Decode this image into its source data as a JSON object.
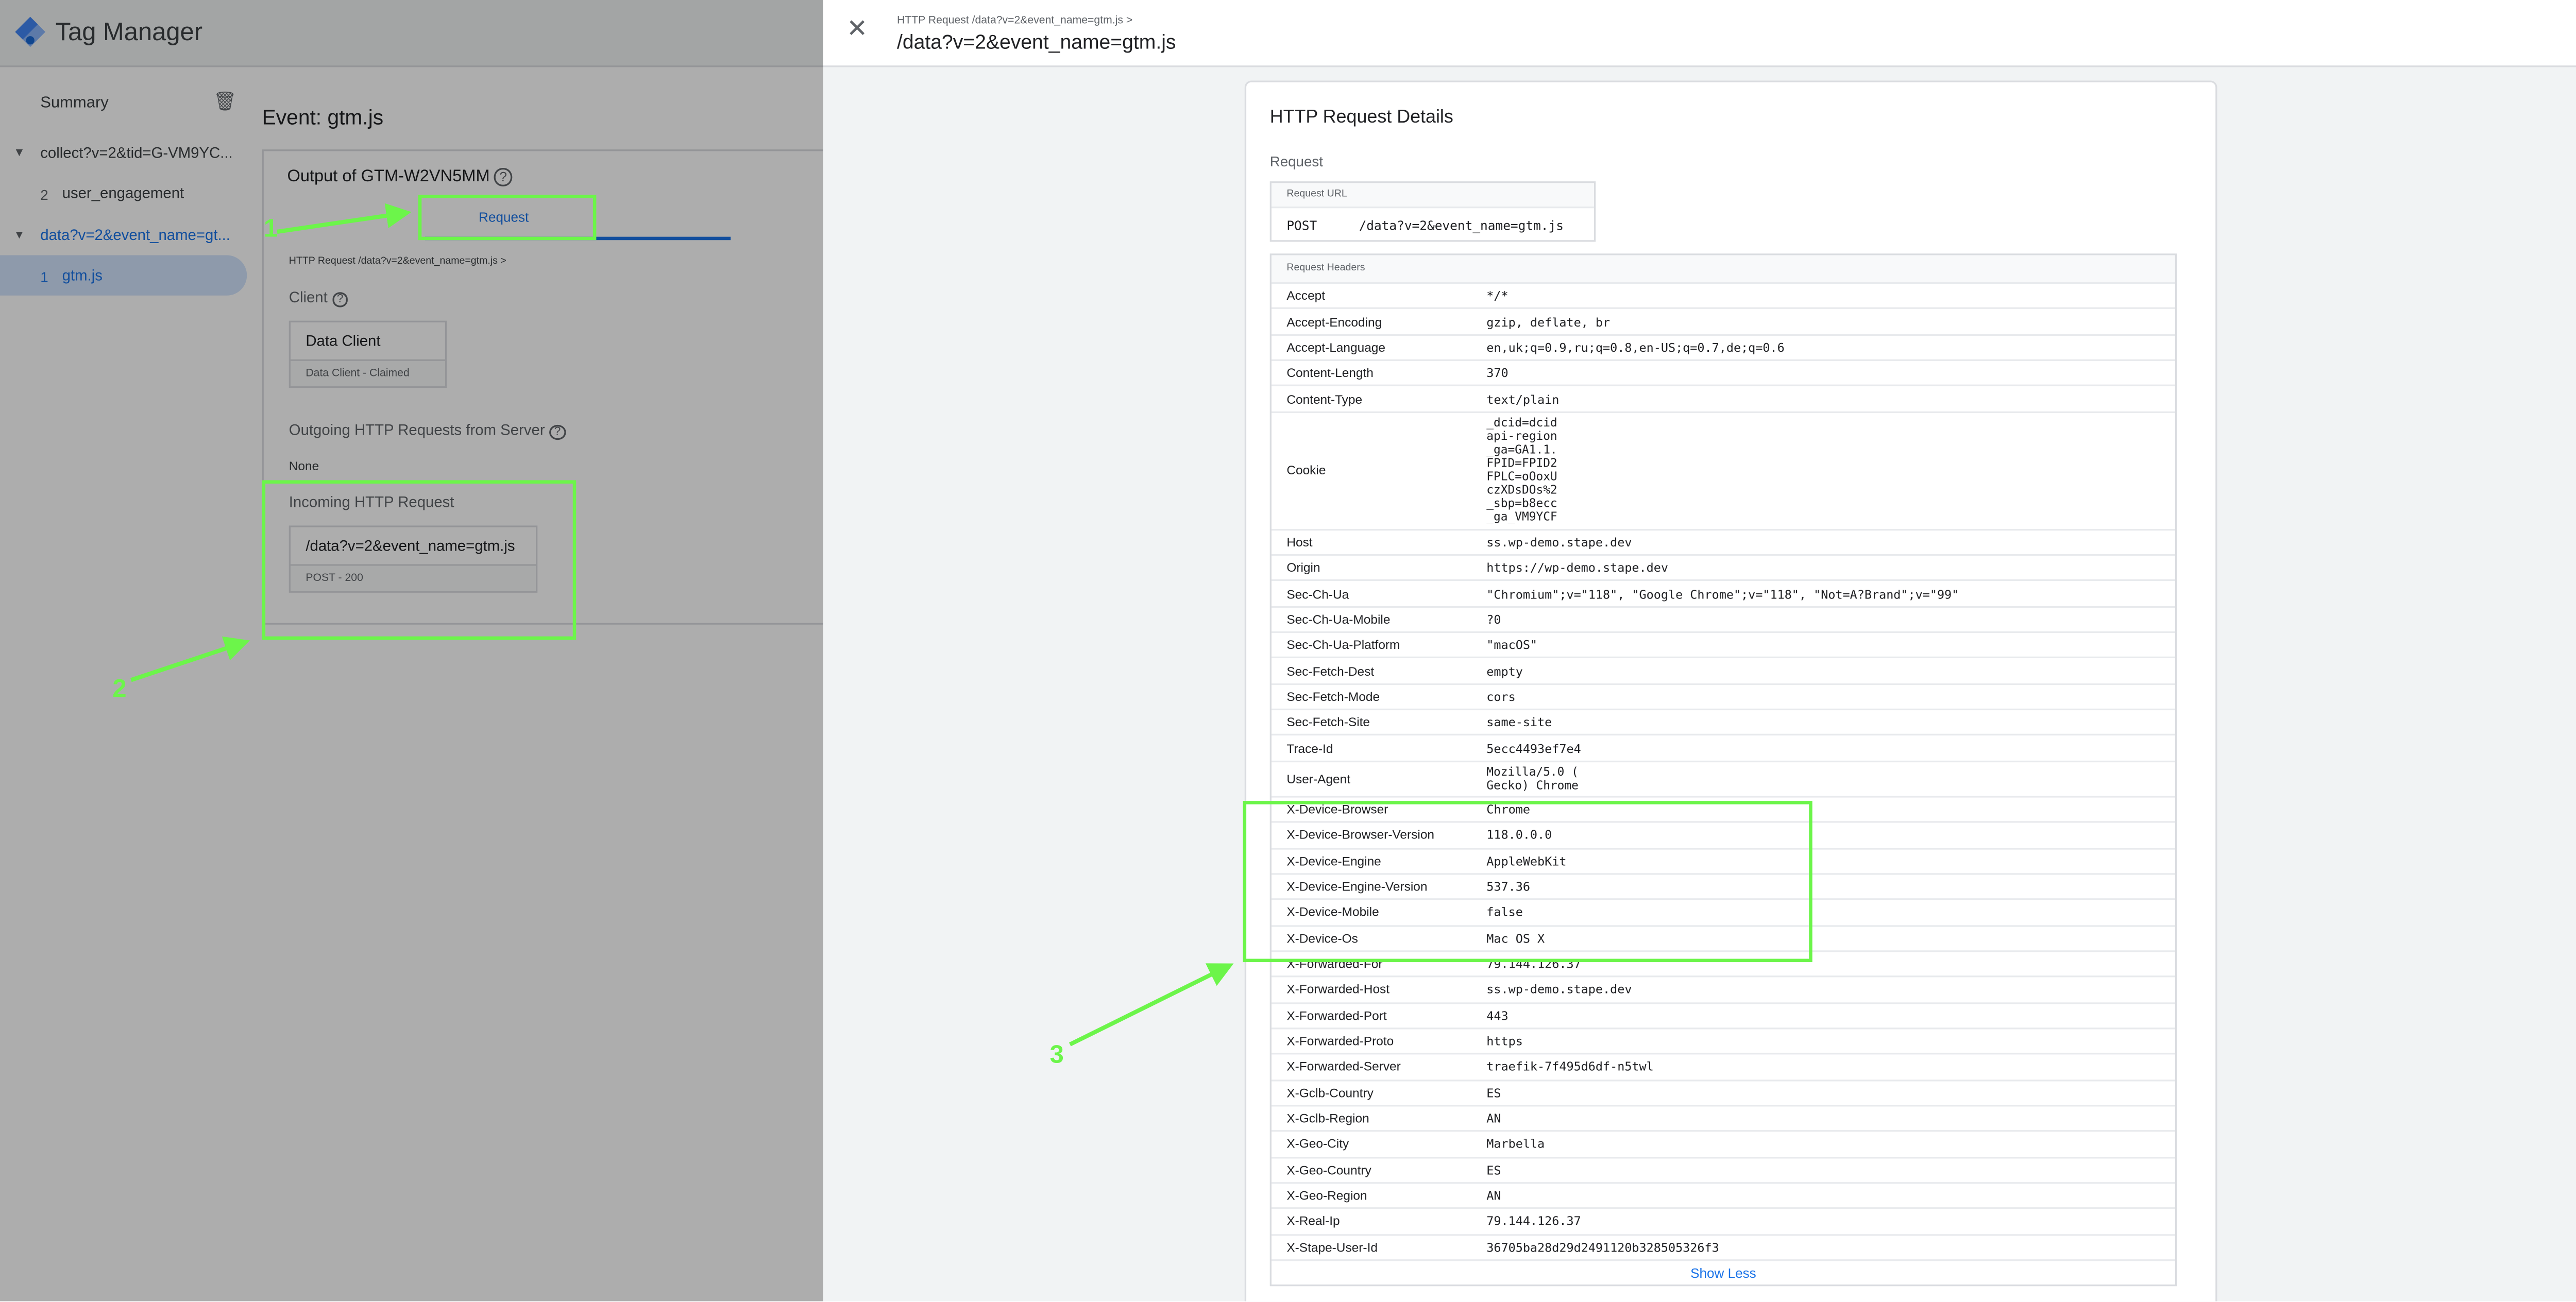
{
  "app": {
    "title": "Tag Manager"
  },
  "sidebar": {
    "summary": "Summary",
    "items": [
      {
        "label": "collect?v=2&tid=G-VM9YC..."
      },
      {
        "num": "2",
        "label": "user_engagement"
      },
      {
        "label": "data?v=2&event_name=gt..."
      },
      {
        "num": "1",
        "label": "gtm.js"
      }
    ]
  },
  "main": {
    "event_title": "Event: gtm.js",
    "card_title": "Output of GTM-W2VN5MM",
    "tab_request": "Request",
    "breadcrumb": "HTTP Request /data?v=2&event_name=gtm.js   >",
    "client_label": "Client",
    "client_name": "Data Client",
    "client_status": "Data Client - Claimed",
    "outgoing_label": "Outgoing HTTP Requests from Server",
    "outgoing_value": "None",
    "incoming_label": "Incoming HTTP Request",
    "incoming_path": "/data?v=2&event_name=gtm.js",
    "incoming_status": "POST - 200"
  },
  "drawer": {
    "subtitle": "HTTP Request /data?v=2&event_name=gtm.js >",
    "title": "/data?v=2&event_name=gtm.js",
    "details_title": "HTTP Request Details",
    "request_label": "Request",
    "url_caption": "Request URL",
    "method": "POST",
    "path": "/data?v=2&event_name=gtm.js",
    "headers_caption": "Request Headers",
    "headers": [
      {
        "k": "Accept",
        "v": "*/*"
      },
      {
        "k": "Accept-Encoding",
        "v": "gzip, deflate, br"
      },
      {
        "k": "Accept-Language",
        "v": "en,uk;q=0.9,ru;q=0.8,en-US;q=0.7,de;q=0.6"
      },
      {
        "k": "Content-Length",
        "v": "370"
      },
      {
        "k": "Content-Type",
        "v": "text/plain"
      },
      {
        "k": "Cookie",
        "v": "_dcid=dcid\napi-region\n_ga=GA1.1.\nFPID=FPID2\nFPLC=oOoxU\nczXDsDOs%2\n_sbp=b8ecc\n_ga_VM9YCF"
      },
      {
        "k": "Host",
        "v": "ss.wp-demo.stape.dev"
      },
      {
        "k": "Origin",
        "v": "https://wp-demo.stape.dev"
      },
      {
        "k": "Sec-Ch-Ua",
        "v": "\"Chromium\";v=\"118\", \"Google Chrome\";v=\"118\", \"Not=A?Brand\";v=\"99\""
      },
      {
        "k": "Sec-Ch-Ua-Mobile",
        "v": "?0"
      },
      {
        "k": "Sec-Ch-Ua-Platform",
        "v": "\"macOS\""
      },
      {
        "k": "Sec-Fetch-Dest",
        "v": "empty"
      },
      {
        "k": "Sec-Fetch-Mode",
        "v": "cors"
      },
      {
        "k": "Sec-Fetch-Site",
        "v": "same-site"
      },
      {
        "k": "Trace-Id",
        "v": "5ecc4493ef7e4"
      },
      {
        "k": "User-Agent",
        "v": "Mozilla/5.0 (\nGecko) Chrome"
      },
      {
        "k": "X-Device-Browser",
        "v": "Chrome"
      },
      {
        "k": "X-Device-Browser-Version",
        "v": "118.0.0.0"
      },
      {
        "k": "X-Device-Engine",
        "v": "AppleWebKit"
      },
      {
        "k": "X-Device-Engine-Version",
        "v": "537.36"
      },
      {
        "k": "X-Device-Mobile",
        "v": "false"
      },
      {
        "k": "X-Device-Os",
        "v": "Mac OS X"
      },
      {
        "k": "X-Forwarded-For",
        "v": "79.144.126.37"
      },
      {
        "k": "X-Forwarded-Host",
        "v": "ss.wp-demo.stape.dev"
      },
      {
        "k": "X-Forwarded-Port",
        "v": "443"
      },
      {
        "k": "X-Forwarded-Proto",
        "v": "https"
      },
      {
        "k": "X-Forwarded-Server",
        "v": "traefik-7f495d6df-n5twl"
      },
      {
        "k": "X-Gclb-Country",
        "v": "ES"
      },
      {
        "k": "X-Gclb-Region",
        "v": "AN"
      },
      {
        "k": "X-Geo-City",
        "v": "Marbella"
      },
      {
        "k": "X-Geo-Country",
        "v": "ES"
      },
      {
        "k": "X-Geo-Region",
        "v": "AN"
      },
      {
        "k": "X-Real-Ip",
        "v": "79.144.126.37"
      },
      {
        "k": "X-Stape-User-Id",
        "v": "36705ba28d29d2491120b328505326f3"
      }
    ],
    "show_less": "Show Less"
  },
  "annotations": {
    "n1": "1",
    "n2": "2",
    "n3": "3"
  },
  "colors": {
    "accent": "#1a73e8",
    "annotation": "#6cf54a"
  }
}
